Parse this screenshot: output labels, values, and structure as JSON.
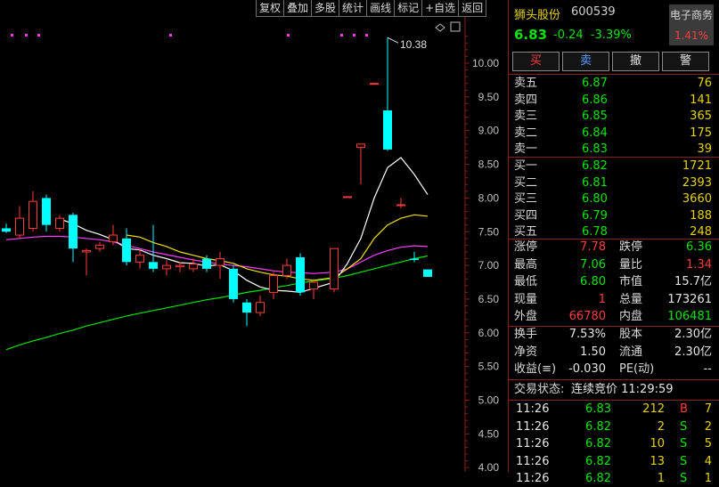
{
  "toolbar": [
    "复权",
    "叠加",
    "多股",
    "统计",
    "画线",
    "标记",
    "+自选",
    "返回"
  ],
  "stock": {
    "name": "狮头股份",
    "code": "600539",
    "price": "6.83",
    "change": "-0.24",
    "pct": "-3.39%",
    "sector": "电子商务",
    "sector_pct": "1.41%"
  },
  "actions": [
    "买",
    "卖",
    "撤",
    "警"
  ],
  "sells": [
    {
      "label": "卖五",
      "price": "6.87",
      "vol": "76"
    },
    {
      "label": "卖四",
      "price": "6.86",
      "vol": "141"
    },
    {
      "label": "卖三",
      "price": "6.85",
      "vol": "365"
    },
    {
      "label": "卖二",
      "price": "6.84",
      "vol": "175"
    },
    {
      "label": "卖一",
      "price": "6.83",
      "vol": "39"
    }
  ],
  "buys": [
    {
      "label": "买一",
      "price": "6.82",
      "vol": "1721"
    },
    {
      "label": "买二",
      "price": "6.81",
      "vol": "2393"
    },
    {
      "label": "买三",
      "price": "6.80",
      "vol": "3660"
    },
    {
      "label": "买四",
      "price": "6.79",
      "vol": "188"
    },
    {
      "label": "买五",
      "price": "6.78",
      "vol": "248"
    }
  ],
  "quote": [
    {
      "l1": "涨停",
      "v1": "7.78",
      "l2": "跌停",
      "v2": "6.36"
    },
    {
      "l1": "最高",
      "v1": "7.06",
      "l2": "量比",
      "v2": "1.34"
    },
    {
      "l1": "最低",
      "v1": "6.80",
      "l2": "市值",
      "v2": "15.7亿"
    },
    {
      "l1": "现量",
      "v1": "1",
      "l2": "总量",
      "v2": "173261"
    },
    {
      "l1": "外盘",
      "v1": "66780",
      "l2": "内盘",
      "v2": "106481"
    }
  ],
  "fund": [
    {
      "l1": "换手",
      "v1": "7.53%",
      "l2": "股本",
      "v2": "2.30亿"
    },
    {
      "l1": "净资",
      "v1": "1.50",
      "l2": "流通",
      "v2": "2.30亿"
    },
    {
      "l1": "收益(≡)",
      "v1": "-0.030",
      "l2": "PE(动)",
      "v2": "--"
    }
  ],
  "status": {
    "label": "交易状态:",
    "value": "连续竞价 11:29:59"
  },
  "ticks": [
    {
      "time": "11:26",
      "price": "6.83",
      "vol": "212",
      "side": "B",
      "n": "7"
    },
    {
      "time": "11:26",
      "price": "6.82",
      "vol": "2",
      "side": "S",
      "n": "2"
    },
    {
      "time": "11:26",
      "price": "6.82",
      "vol": "10",
      "side": "S",
      "n": "5"
    },
    {
      "time": "11:26",
      "price": "6.82",
      "vol": "13",
      "side": "S",
      "n": "4"
    },
    {
      "time": "11:26",
      "price": "6.82",
      "vol": "1",
      "side": "S",
      "n": "1"
    }
  ],
  "colors": {
    "up": "#ff3b3b",
    "down": "#00ffff",
    "ma5": "#ffffff",
    "ma10": "#f2e400",
    "ma20": "#ff3bff",
    "ma60": "#00e600"
  },
  "chart_data": {
    "type": "candlestick",
    "ylim": [
      4.0,
      10.5
    ],
    "yticks": [
      "10.00",
      "9.50",
      "9.00",
      "8.50",
      "8.00",
      "7.50",
      "7.00",
      "6.50",
      "6.00",
      "5.50",
      "5.00",
      "4.50",
      "4.00"
    ],
    "max_label": "10.38",
    "candles": [
      {
        "o": 7.55,
        "h": 7.62,
        "l": 7.48,
        "c": 7.5
      },
      {
        "o": 7.45,
        "h": 7.88,
        "l": 7.4,
        "c": 7.7
      },
      {
        "o": 7.55,
        "h": 8.1,
        "l": 7.5,
        "c": 7.95
      },
      {
        "o": 8.0,
        "h": 8.05,
        "l": 7.5,
        "c": 7.6
      },
      {
        "o": 7.55,
        "h": 7.75,
        "l": 7.5,
        "c": 7.7
      },
      {
        "o": 7.75,
        "h": 7.78,
        "l": 7.05,
        "c": 7.25
      },
      {
        "o": 7.2,
        "h": 7.25,
        "l": 6.85,
        "c": 7.22
      },
      {
        "o": 7.25,
        "h": 7.35,
        "l": 7.2,
        "c": 7.3
      },
      {
        "o": 7.35,
        "h": 7.6,
        "l": 7.3,
        "c": 7.45
      },
      {
        "o": 7.4,
        "h": 7.55,
        "l": 7.0,
        "c": 7.05
      },
      {
        "o": 7.05,
        "h": 7.25,
        "l": 6.95,
        "c": 7.15
      },
      {
        "o": 7.05,
        "h": 7.6,
        "l": 6.9,
        "c": 6.95
      },
      {
        "o": 6.95,
        "h": 7.08,
        "l": 6.85,
        "c": 7.0
      },
      {
        "o": 6.98,
        "h": 7.05,
        "l": 6.9,
        "c": 7.0
      },
      {
        "o": 6.95,
        "h": 7.1,
        "l": 6.9,
        "c": 7.02
      },
      {
        "o": 7.1,
        "h": 7.15,
        "l": 6.9,
        "c": 6.95
      },
      {
        "o": 7.0,
        "h": 7.2,
        "l": 6.8,
        "c": 7.1
      },
      {
        "o": 6.95,
        "h": 7.0,
        "l": 6.45,
        "c": 6.5
      },
      {
        "o": 6.45,
        "h": 6.5,
        "l": 6.1,
        "c": 6.3
      },
      {
        "o": 6.3,
        "h": 6.55,
        "l": 6.25,
        "c": 6.45
      },
      {
        "o": 6.6,
        "h": 6.9,
        "l": 6.5,
        "c": 6.85
      },
      {
        "o": 6.85,
        "h": 7.1,
        "l": 6.8,
        "c": 7.0
      },
      {
        "o": 7.12,
        "h": 7.18,
        "l": 6.55,
        "c": 6.6
      },
      {
        "o": 6.65,
        "h": 6.8,
        "l": 6.5,
        "c": 6.75
      },
      {
        "o": 6.65,
        "h": 7.25,
        "l": 6.6,
        "c": 7.25
      },
      {
        "o": 8.02,
        "h": 8.02,
        "l": 8.02,
        "c": 8.02
      },
      {
        "o": 8.75,
        "h": 8.8,
        "l": 8.2,
        "c": 8.8
      },
      {
        "o": 9.7,
        "h": 9.7,
        "l": 9.7,
        "c": 9.7
      },
      {
        "o": 9.3,
        "h": 10.38,
        "l": 8.7,
        "c": 8.72
      },
      {
        "o": 7.9,
        "h": 8.0,
        "l": 7.85,
        "c": 7.9
      },
      {
        "o": 7.1,
        "h": 7.2,
        "l": 7.05,
        "c": 7.08
      },
      {
        "o": 6.94,
        "h": 6.94,
        "l": 6.83,
        "c": 6.83
      }
    ],
    "ma5": [
      null,
      null,
      null,
      null,
      7.69,
      7.62,
      7.52,
      7.46,
      7.38,
      7.25,
      7.23,
      7.15,
      7.1,
      7.04,
      7.03,
      6.99,
      7.01,
      6.92,
      6.78,
      6.68,
      6.63,
      6.62,
      6.6,
      6.66,
      6.75,
      7.03,
      7.4,
      8.0,
      8.45,
      8.6,
      8.35,
      8.05
    ],
    "ma10": [
      null,
      null,
      null,
      null,
      null,
      null,
      null,
      null,
      null,
      7.45,
      7.42,
      7.34,
      7.28,
      7.2,
      7.15,
      7.1,
      7.07,
      7.03,
      6.95,
      6.9,
      6.86,
      6.84,
      6.8,
      6.78,
      6.82,
      6.95,
      7.1,
      7.4,
      7.6,
      7.7,
      7.75,
      7.73
    ],
    "ma20": [
      7.38,
      7.4,
      7.42,
      7.43,
      7.43,
      7.42,
      7.4,
      7.38,
      7.35,
      7.3,
      7.25,
      7.2,
      7.16,
      7.12,
      7.08,
      7.05,
      7.02,
      7.0,
      6.98,
      6.95,
      6.92,
      6.9,
      6.89,
      6.88,
      6.9,
      6.95,
      7.05,
      7.15,
      7.22,
      7.27,
      7.29,
      7.28
    ],
    "ma60": [
      5.75,
      5.82,
      5.88,
      5.93,
      5.99,
      6.04,
      6.1,
      6.15,
      6.2,
      6.25,
      6.29,
      6.33,
      6.37,
      6.41,
      6.45,
      6.49,
      6.52,
      6.56,
      6.6,
      6.63,
      6.67,
      6.7,
      6.74,
      6.77,
      6.81,
      6.85,
      6.9,
      6.95,
      7.0,
      7.05,
      7.1,
      7.14
    ]
  }
}
